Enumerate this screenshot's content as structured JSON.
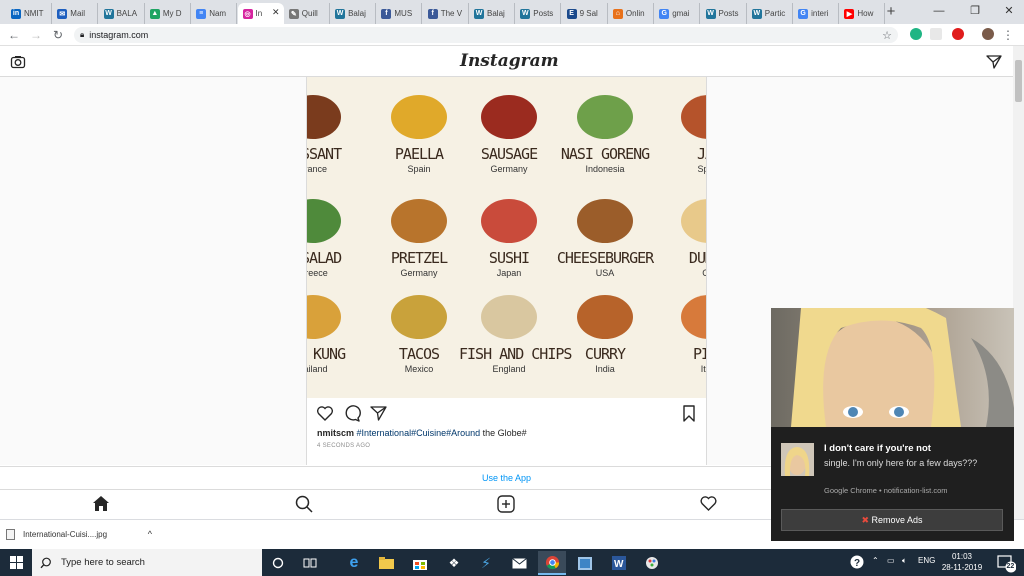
{
  "browser": {
    "tabs": [
      {
        "label": "NMIT",
        "color": "#0a66c2",
        "glyph": "in"
      },
      {
        "label": "Mail",
        "color": "#1e5fbf",
        "glyph": "✉"
      },
      {
        "label": "BALA",
        "color": "#21759b",
        "glyph": "W"
      },
      {
        "label": "My D",
        "color": "#1fa463",
        "glyph": "▲"
      },
      {
        "label": "Nam",
        "color": "#4285f4",
        "glyph": "≡"
      },
      {
        "label": "In",
        "color": "#d6249f",
        "glyph": "◎",
        "active": true
      },
      {
        "label": "Quill",
        "color": "#777777",
        "glyph": "✎"
      },
      {
        "label": "Balaj",
        "color": "#21759b",
        "glyph": "W"
      },
      {
        "label": "MUS",
        "color": "#3b5998",
        "glyph": "f"
      },
      {
        "label": "The V",
        "color": "#3b5998",
        "glyph": "f"
      },
      {
        "label": "Balaj",
        "color": "#21759b",
        "glyph": "W"
      },
      {
        "label": "Posts",
        "color": "#21759b",
        "glyph": "W"
      },
      {
        "label": "9 Sal",
        "color": "#1b4a8c",
        "glyph": "E"
      },
      {
        "label": "Onlin",
        "color": "#e8711a",
        "glyph": "⌂"
      },
      {
        "label": "gmai",
        "color": "#4285f4",
        "glyph": "G"
      },
      {
        "label": "Posts",
        "color": "#21759b",
        "glyph": "W"
      },
      {
        "label": "Partic",
        "color": "#21759b",
        "glyph": "W"
      },
      {
        "label": "interi",
        "color": "#4285f4",
        "glyph": "G"
      },
      {
        "label": "How",
        "color": "#ff0000",
        "glyph": "▶"
      }
    ],
    "new_tab": "+",
    "window_controls": {
      "minimize": "—",
      "maximize": "❐",
      "close": "✕"
    },
    "url": "instagram.com"
  },
  "instagram": {
    "logo": "Instagram",
    "post": {
      "foods": [
        {
          "name": "OISSANT",
          "country": "France"
        },
        {
          "name": "PAELLA",
          "country": "Spain"
        },
        {
          "name": "SAUSAGE",
          "country": "Germany"
        },
        {
          "name": "NASI GORENG",
          "country": "Indonesia"
        },
        {
          "name": "JAM",
          "country": "Spain"
        },
        {
          "name": "K SALAD",
          "country": "Greece"
        },
        {
          "name": "PRETZEL",
          "country": "Germany"
        },
        {
          "name": "SUSHI",
          "country": "Japan"
        },
        {
          "name": "CHEESEBURGER",
          "country": "USA"
        },
        {
          "name": "DUMPL",
          "country": "Chi"
        },
        {
          "name": "YUM KUNG",
          "country": "hailand"
        },
        {
          "name": "TACOS",
          "country": "Mexico"
        },
        {
          "name": "FISH AND CHIPS",
          "country": "England"
        },
        {
          "name": "CURRY",
          "country": "India"
        },
        {
          "name": "PIZZ",
          "country": "Italy"
        }
      ],
      "username": "nmitscm",
      "caption_tags": "#International#Cuisine#Around",
      "caption_rest": " the Globe#",
      "time_ago": "4 SECONDS AGO"
    },
    "use_app": "Use the App"
  },
  "download": {
    "filename": "International-Cuisi....jpg",
    "chevron": "^"
  },
  "notification": {
    "title": "I don't care if you're not",
    "body": "single. I'm only here for a few days???",
    "source": "Google Chrome • notification-list.com",
    "button": "Remove Ads",
    "button_icon": "✖"
  },
  "taskbar": {
    "search_placeholder": "Type here to search",
    "language": "ENG",
    "time": "01:03",
    "date": "28-11-2019",
    "notification_count": "22"
  }
}
